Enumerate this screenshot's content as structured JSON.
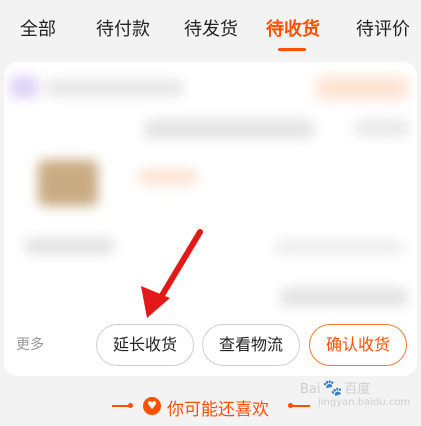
{
  "tabs": [
    {
      "label": "全部"
    },
    {
      "label": "待付款"
    },
    {
      "label": "待发货"
    },
    {
      "label": "待收货",
      "active": true
    },
    {
      "label": "待评价"
    }
  ],
  "order": {
    "more_label": "更多",
    "buttons": {
      "extend": "延长收货",
      "logistics": "查看物流",
      "confirm": "确认收货"
    }
  },
  "recommend": {
    "title": "你可能还喜欢",
    "icon": "heart-icon"
  },
  "watermark": {
    "brand_left": "Bai",
    "brand_right": "百度",
    "sub": "jingyan.baidu.com"
  },
  "colors": {
    "accent": "#ff5000",
    "arrow": "#e11919"
  }
}
